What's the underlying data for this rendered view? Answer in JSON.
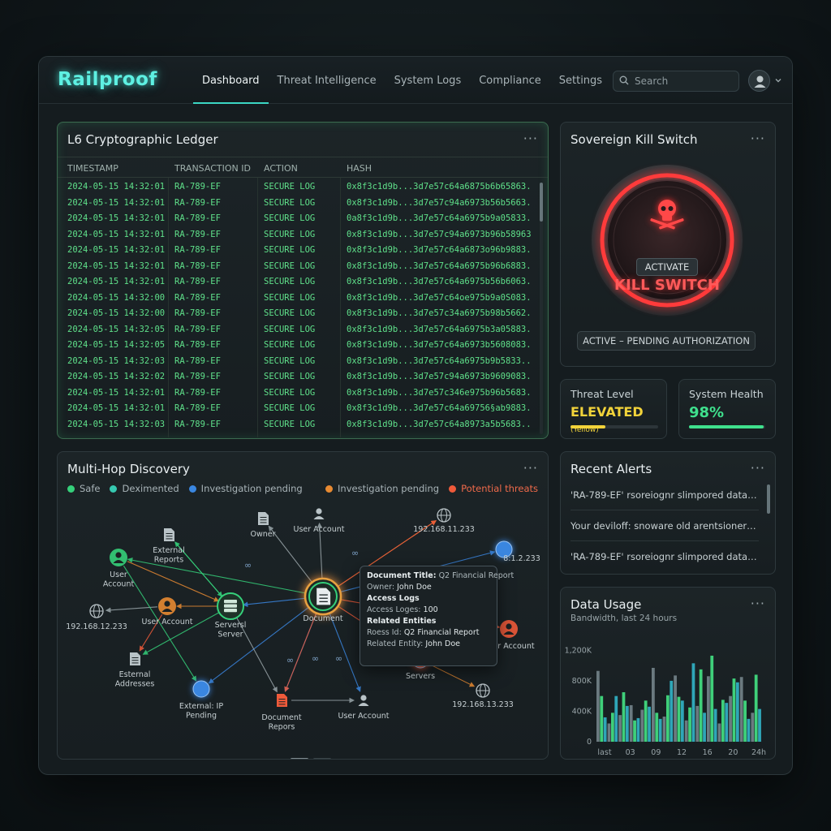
{
  "app": {
    "logo": "Railproof"
  },
  "nav": [
    "Dashboard",
    "Threat Intelligence",
    "System Logs",
    "Compliance",
    "Settings"
  ],
  "search": {
    "placeholder": "Search"
  },
  "ledger": {
    "title": "L6 Cryptographic Ledger",
    "columns": [
      "TIMESTAMP",
      "TRANSACTION ID",
      "ACTION",
      "HASH"
    ],
    "rows": [
      [
        "2024-05-15 14:32:01",
        "RA-789-EF",
        "SECURE LOG",
        "0x8f3c1d9b...3d7e57c64a6875b6b65863..."
      ],
      [
        "2024-05-15 14:32:01",
        "RA-789-EF",
        "SECURE LOG",
        "0x8f3c1d9b...3d7e57c94a6973b56b5663..."
      ],
      [
        "2024-05-15 14:32:01",
        "RA-789-EF",
        "SECURE LOG",
        "0a8f3c1d9b...3d7e57c64a6975b9a05833..."
      ],
      [
        "2024-05-15 14:32:01",
        "RA-789-EF",
        "SECURE LOG",
        "0x8f3c1d9b...3d7e57c94a6973b96b58963..."
      ],
      [
        "2024-05-15 14:32:01",
        "RA-789-EF",
        "SECURE LOG",
        "0x8f3c1d9b...3d7e57c64a6873o96b9883..."
      ],
      [
        "2024-05-15 14:32:01",
        "RA-789-EF",
        "SECURE LOG",
        "0x8f3c1d9b...3d7e57c64a6975b96b6883..."
      ],
      [
        "2024-05-15 14:32:01",
        "RA-789-EF",
        "SECURE LOG",
        "0x8f3c1d9b...3d7e57c64a6975b56b6063..."
      ],
      [
        "2024-05-15 14:32:00",
        "RA-789-EF",
        "SECURE LOG",
        "0x8f3c1d9b...3d7e57c64oe975b9a0S083..."
      ],
      [
        "2024-05-15 14:32:00",
        "RA-789-EF",
        "SECURE LOG",
        "0x8f3c1d9b...3d7e57c34a6975b98b5662..."
      ],
      [
        "2024-05-15 14:32:05",
        "RA-789-EF",
        "SECURE LOG",
        "0x8f3c1d9b...3d7e57c64a6975b3a05883..."
      ],
      [
        "2024-05-15 14:32:05",
        "RA-789-EF",
        "SECURE LOG",
        "0x8f3c1d9b...3d7e57c64a6973b5608083..."
      ],
      [
        "2024-05-15 14:32:03",
        "RA-789-EF",
        "SECURE LOG",
        "0x8f3c1d9b...3d7e57c64a6975b9b5833..."
      ],
      [
        "2024-05-15 14:32:02",
        "RA-789-EF",
        "SECURE LOG",
        "0x8f3c1d9b...3d7e57c94a6973b9609083..."
      ],
      [
        "2024-05-15 14:32:01",
        "RA-789-EF",
        "SECURE LOG",
        "0x8f3c1d9b...3d7e57c346e975b96b5683..."
      ],
      [
        "2024-05-15 14:32:01",
        "RA-789-EF",
        "SECURE LOG",
        "0x8f3c1d9b...3d7e57c64a69756§ab9883..."
      ],
      [
        "2024-05-15 14:32:03",
        "RA-789-EF",
        "SECURE LOG",
        "0x8f3c1d9b...3d7e57c64a8973a5b5683..."
      ]
    ]
  },
  "kill_switch": {
    "title": "Sovereign Kill Switch",
    "label": "KILL SWITCH",
    "activate": "ACTIVATE",
    "status": "ACTIVE – PENDING AUTHORIZATION"
  },
  "threat": {
    "label": "Threat Level",
    "value": "ELEVATED",
    "sub": "(Yellow)",
    "level": 0.4,
    "color": "#f2d33a"
  },
  "health": {
    "label": "System Health",
    "value": "98%",
    "level": 0.98,
    "color": "#3fe08d"
  },
  "discovery": {
    "title": "Multi-Hop Discovery",
    "legend_left": [
      {
        "label": "Safe",
        "color": "#35d07a"
      },
      {
        "label": "Deximented",
        "color": "#36c9b0"
      },
      {
        "label": "Investigation pending",
        "color": "#3a86e0"
      }
    ],
    "legend_right": [
      {
        "label": "Investigation pending",
        "color": "#e88a32"
      },
      {
        "label": "Potential threats",
        "color": "#ef5a3a"
      }
    ],
    "nodes": [
      {
        "id": "owner",
        "label": "Owner",
        "icon": "doc",
        "color": "#b9c3c7"
      },
      {
        "id": "ua_top",
        "label": "User Account",
        "icon": "user",
        "color": "#b9c3c7"
      },
      {
        "id": "ip_top",
        "label": "192.168.11.233",
        "icon": "globe",
        "color": "#b9c3c7"
      },
      {
        "id": "ext_reports",
        "label": "External Reports",
        "icon": "doc",
        "color": "#b9c3c7"
      },
      {
        "id": "ua_green",
        "label": "User Account",
        "icon": "user",
        "color": "#35d07a"
      },
      {
        "id": "ip_left",
        "label": "192.168.12.233",
        "icon": "globe",
        "color": "#b9c3c7"
      },
      {
        "id": "ua_orange",
        "label": "User Account",
        "icon": "user",
        "color": "#e88a32"
      },
      {
        "id": "servers",
        "label": "Serversl Server",
        "icon": "server",
        "color": "#35d07a"
      },
      {
        "id": "document",
        "label": "Document",
        "icon": "doc",
        "color": "#e8a040"
      },
      {
        "id": "ext_addr",
        "label": "Esternal Addresses",
        "icon": "doc",
        "color": "#b9c3c7"
      },
      {
        "id": "ext_ip",
        "label": "External: IP Pending",
        "icon": "dot",
        "color": "#3a86e0"
      },
      {
        "id": "doc_reports",
        "label": "Document Repors",
        "icon": "doc",
        "color": "#ef5a3a"
      },
      {
        "id": "ua_bottom",
        "label": "User Account",
        "icon": "user",
        "color": "#b9c3c7"
      },
      {
        "id": "blue_right",
        "label": "8:1.2.233",
        "icon": "dot",
        "color": "#3a86e0"
      },
      {
        "id": "ua_right",
        "label": "er Account",
        "icon": "user",
        "color": "#ef5a3a"
      },
      {
        "id": "servers_r",
        "label": "Servers",
        "icon": "dot",
        "color": "#ef5a3a"
      },
      {
        "id": "ip_bottom",
        "label": "192.168.13.233",
        "icon": "globe",
        "color": "#b9c3c7"
      }
    ],
    "edge_labels": [
      "∞",
      "∞",
      "∞",
      "∞",
      "∞",
      "∞",
      "∞"
    ],
    "tooltip": {
      "doc_title_label": "Document Title:",
      "doc_title": "Q2 Financial Report",
      "owner_label": "Owner:",
      "owner": "John Doe",
      "access_logs": "Access Logs",
      "access_label": "Access Loges:",
      "access_value": "100",
      "related": "Related Entities",
      "roess_label": "Roess Id:",
      "roess_value": "Q2 Financial Report",
      "entity_label": "Related Entity:",
      "entity_value": "John Doe"
    }
  },
  "alerts": {
    "title": "Recent Alerts",
    "items": [
      "'RA-789-EF' rsoreiognr slimpored data fimes...",
      "Your deviloff: snoware old arentsioner avd...",
      "'RA-789-EF' rsoreiognr slimpored data fimes..."
    ]
  },
  "chart_data": {
    "type": "bar",
    "title": "Data Usage",
    "subtitle": "Bandwidth, last 24 hours",
    "y_ticks": [
      "0",
      "400K",
      "800K",
      "1,200K"
    ],
    "ylim": [
      0,
      1300
    ],
    "x_ticks": [
      "last",
      "03",
      "09",
      "12",
      "16",
      "20",
      "24h"
    ],
    "series": [
      {
        "color": "#6b7a80",
        "values": [
          930,
          240,
          350,
          480,
          420,
          970,
          330,
          870,
          280,
          470,
          860,
          240,
          600,
          850,
          380
        ]
      },
      {
        "color": "#3fd07a",
        "values": [
          600,
          380,
          650,
          280,
          540,
          380,
          610,
          590,
          450,
          950,
          1130,
          550,
          830,
          540,
          880
        ]
      },
      {
        "color": "#2fa6b8",
        "values": [
          320,
          600,
          470,
          310,
          460,
          300,
          800,
          540,
          1030,
          380,
          430,
          510,
          780,
          300,
          430
        ]
      }
    ]
  }
}
